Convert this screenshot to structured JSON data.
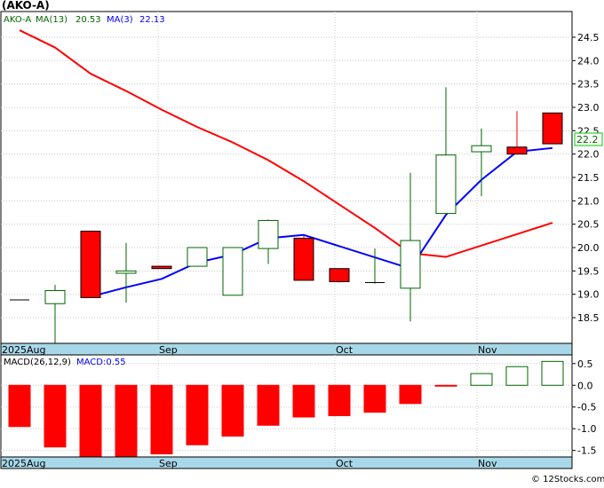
{
  "title": "(AKO-A)",
  "legend": {
    "symbol": "AKO-A",
    "ma13_label": "MA(13)",
    "ma13_value": "20.53",
    "ma3_label": "MA(3)",
    "ma3_value": "22.13"
  },
  "macd_legend": {
    "label": "MACD(26,12,9)",
    "value_label": "MACD:0.55"
  },
  "last_price_tag": "22.2",
  "watermark": "© 12Stocks.com",
  "colors": {
    "up": "#006400",
    "down": "#ff0000",
    "ma13": "#ff0000",
    "ma3": "#0000ff",
    "grid": "#c8c8c8",
    "axis_band": "#a8d8e8"
  },
  "chart_data": [
    {
      "type": "candlestick",
      "title": "(AKO-A)",
      "x_tick_labels": [
        "2025Aug",
        "Sep",
        "Oct",
        "Nov"
      ],
      "y_tick_labels": [
        "18.5",
        "19.0",
        "19.5",
        "20.0",
        "20.5",
        "21.0",
        "21.5",
        "22.0",
        "22.5",
        "23.0",
        "23.5",
        "24.0",
        "24.5"
      ],
      "ylim": [
        17.95,
        25.05
      ],
      "grid": true,
      "candles": [
        {
          "open": 18.88,
          "high": 18.88,
          "low": 18.88,
          "close": 18.88
        },
        {
          "open": 18.8,
          "high": 19.2,
          "low": 17.9,
          "close": 19.08
        },
        {
          "open": 20.35,
          "high": 20.35,
          "low": 18.93,
          "close": 18.93
        },
        {
          "open": 19.45,
          "high": 20.1,
          "low": 18.82,
          "close": 19.5
        },
        {
          "open": 19.6,
          "high": 19.6,
          "low": 19.55,
          "close": 19.55
        },
        {
          "open": 19.6,
          "high": 20.0,
          "low": 19.6,
          "close": 20.0
        },
        {
          "open": 18.98,
          "high": 20.0,
          "low": 18.98,
          "close": 20.0
        },
        {
          "open": 19.98,
          "high": 20.6,
          "low": 19.65,
          "close": 20.58
        },
        {
          "open": 20.2,
          "high": 20.25,
          "low": 19.3,
          "close": 19.3
        },
        {
          "open": 19.55,
          "high": 19.55,
          "low": 19.25,
          "close": 19.27
        },
        {
          "open": 19.25,
          "high": 19.98,
          "low": 19.23,
          "close": 19.25
        },
        {
          "open": 19.13,
          "high": 21.6,
          "low": 18.42,
          "close": 20.15
        },
        {
          "open": 20.73,
          "high": 23.43,
          "low": 20.73,
          "close": 21.98
        },
        {
          "open": 22.05,
          "high": 22.55,
          "low": 21.1,
          "close": 22.18
        },
        {
          "open": 22.15,
          "high": 22.92,
          "low": 22.0,
          "close": 22.0
        },
        {
          "open": 22.88,
          "high": 22.88,
          "low": 22.22,
          "close": 22.22
        }
      ],
      "series": [
        {
          "name": "MA(13)",
          "values": [
            24.65,
            24.28,
            23.72,
            23.35,
            22.95,
            22.58,
            22.25,
            21.87,
            21.42,
            20.92,
            20.42,
            19.88,
            19.8,
            null,
            null,
            20.53
          ]
        },
        {
          "name": "MA(3)",
          "values": [
            null,
            null,
            18.95,
            19.15,
            19.33,
            19.68,
            19.85,
            20.2,
            20.27,
            null,
            null,
            19.55,
            20.7,
            21.45,
            22.05,
            22.13
          ]
        }
      ]
    },
    {
      "type": "bar",
      "title": "MACD(26,12,9)",
      "x_tick_labels": [
        "2025Aug",
        "Sep",
        "Oct",
        "Nov"
      ],
      "y_tick_labels": [
        "0.5",
        "0.0",
        "-0.5",
        "-1.0",
        "-1.5"
      ],
      "ylim": [
        -1.65,
        0.7
      ],
      "grid": true,
      "values": [
        -0.95,
        -1.42,
        -1.65,
        -1.65,
        -1.58,
        -1.37,
        -1.17,
        -0.92,
        -0.73,
        -0.7,
        -0.62,
        -0.42,
        -0.02,
        0.27,
        0.43,
        0.55
      ]
    }
  ]
}
